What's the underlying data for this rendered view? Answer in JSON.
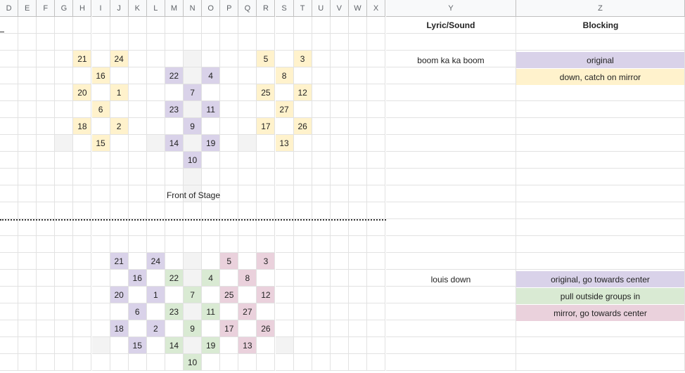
{
  "columns": [
    "D",
    "E",
    "F",
    "G",
    "H",
    "I",
    "J",
    "K",
    "L",
    "M",
    "N",
    "O",
    "P",
    "Q",
    "R",
    "S",
    "T",
    "U",
    "V",
    "W",
    "X",
    "Y",
    "Z"
  ],
  "colors": {
    "yellow": "#fff2cc",
    "purple": "#d9d2e9",
    "green": "#d9ead3",
    "pink": "#ead1dc",
    "stage_gray": "#efefef",
    "gray_cell": "#f3f3f3"
  },
  "table": {
    "header_y": "Lyric/Sound",
    "header_z": "Blocking",
    "rows": [
      {
        "lyric": "boom ka ka boom",
        "blocking": "original",
        "color": "purple"
      },
      {
        "lyric": "",
        "blocking": "down, catch on mirror",
        "color": "yellow"
      },
      {
        "lyric": "louis down",
        "blocking": "original, go towards center",
        "color": "purple"
      },
      {
        "lyric": "",
        "blocking": "pull outside groups in",
        "color": "green"
      },
      {
        "lyric": "",
        "blocking": "mirror, go towards center",
        "color": "pink"
      }
    ]
  },
  "stage_label": "Front of Stage",
  "formation1": [
    {
      "n": "21",
      "col": "H",
      "row": 3,
      "color": "yellow"
    },
    {
      "n": "24",
      "col": "J",
      "row": 3,
      "color": "yellow"
    },
    {
      "n": "5",
      "col": "R",
      "row": 3,
      "color": "yellow"
    },
    {
      "n": "3",
      "col": "T",
      "row": 3,
      "color": "yellow"
    },
    {
      "n": "16",
      "col": "I",
      "row": 4,
      "color": "yellow"
    },
    {
      "n": "22",
      "col": "M",
      "row": 4,
      "color": "purple"
    },
    {
      "n": "4",
      "col": "O",
      "row": 4,
      "color": "purple"
    },
    {
      "n": "8",
      "col": "S",
      "row": 4,
      "color": "yellow"
    },
    {
      "n": "20",
      "col": "H",
      "row": 5,
      "color": "yellow"
    },
    {
      "n": "1",
      "col": "J",
      "row": 5,
      "color": "yellow"
    },
    {
      "n": "7",
      "col": "N",
      "row": 5,
      "color": "purple"
    },
    {
      "n": "25",
      "col": "R",
      "row": 5,
      "color": "yellow"
    },
    {
      "n": "12",
      "col": "T",
      "row": 5,
      "color": "yellow"
    },
    {
      "n": "6",
      "col": "I",
      "row": 6,
      "color": "yellow"
    },
    {
      "n": "23",
      "col": "M",
      "row": 6,
      "color": "purple"
    },
    {
      "n": "11",
      "col": "O",
      "row": 6,
      "color": "purple"
    },
    {
      "n": "27",
      "col": "S",
      "row": 6,
      "color": "yellow"
    },
    {
      "n": "18",
      "col": "H",
      "row": 7,
      "color": "yellow"
    },
    {
      "n": "2",
      "col": "J",
      "row": 7,
      "color": "yellow"
    },
    {
      "n": "9",
      "col": "N",
      "row": 7,
      "color": "purple"
    },
    {
      "n": "17",
      "col": "R",
      "row": 7,
      "color": "yellow"
    },
    {
      "n": "26",
      "col": "T",
      "row": 7,
      "color": "yellow"
    },
    {
      "n": "15",
      "col": "I",
      "row": 8,
      "color": "yellow"
    },
    {
      "n": "14",
      "col": "M",
      "row": 8,
      "color": "purple"
    },
    {
      "n": "19",
      "col": "O",
      "row": 8,
      "color": "purple"
    },
    {
      "n": "13",
      "col": "S",
      "row": 8,
      "color": "yellow"
    },
    {
      "n": "10",
      "col": "N",
      "row": 9,
      "color": "purple"
    }
  ],
  "formation2": [
    {
      "n": "21",
      "col": "J",
      "row": 15,
      "color": "purple"
    },
    {
      "n": "24",
      "col": "L",
      "row": 15,
      "color": "purple"
    },
    {
      "n": "5",
      "col": "P",
      "row": 15,
      "color": "pink"
    },
    {
      "n": "3",
      "col": "R",
      "row": 15,
      "color": "pink"
    },
    {
      "n": "16",
      "col": "K",
      "row": 16,
      "color": "purple"
    },
    {
      "n": "22",
      "col": "M",
      "row": 16,
      "color": "green"
    },
    {
      "n": "4",
      "col": "O",
      "row": 16,
      "color": "green"
    },
    {
      "n": "8",
      "col": "Q",
      "row": 16,
      "color": "pink"
    },
    {
      "n": "20",
      "col": "J",
      "row": 17,
      "color": "purple"
    },
    {
      "n": "1",
      "col": "L",
      "row": 17,
      "color": "purple"
    },
    {
      "n": "7",
      "col": "N",
      "row": 17,
      "color": "green"
    },
    {
      "n": "25",
      "col": "P",
      "row": 17,
      "color": "pink"
    },
    {
      "n": "12",
      "col": "R",
      "row": 17,
      "color": "pink"
    },
    {
      "n": "6",
      "col": "K",
      "row": 18,
      "color": "purple"
    },
    {
      "n": "23",
      "col": "M",
      "row": 18,
      "color": "green"
    },
    {
      "n": "11",
      "col": "O",
      "row": 18,
      "color": "green"
    },
    {
      "n": "27",
      "col": "Q",
      "row": 18,
      "color": "pink"
    },
    {
      "n": "18",
      "col": "J",
      "row": 19,
      "color": "purple"
    },
    {
      "n": "2",
      "col": "L",
      "row": 19,
      "color": "purple"
    },
    {
      "n": "9",
      "col": "N",
      "row": 19,
      "color": "green"
    },
    {
      "n": "17",
      "col": "P",
      "row": 19,
      "color": "pink"
    },
    {
      "n": "26",
      "col": "R",
      "row": 19,
      "color": "pink"
    },
    {
      "n": "15",
      "col": "K",
      "row": 20,
      "color": "purple"
    },
    {
      "n": "14",
      "col": "M",
      "row": 20,
      "color": "green"
    },
    {
      "n": "19",
      "col": "O",
      "row": 20,
      "color": "green"
    },
    {
      "n": "13",
      "col": "Q",
      "row": 20,
      "color": "pink"
    },
    {
      "n": "10",
      "col": "N",
      "row": 21,
      "color": "green"
    }
  ]
}
